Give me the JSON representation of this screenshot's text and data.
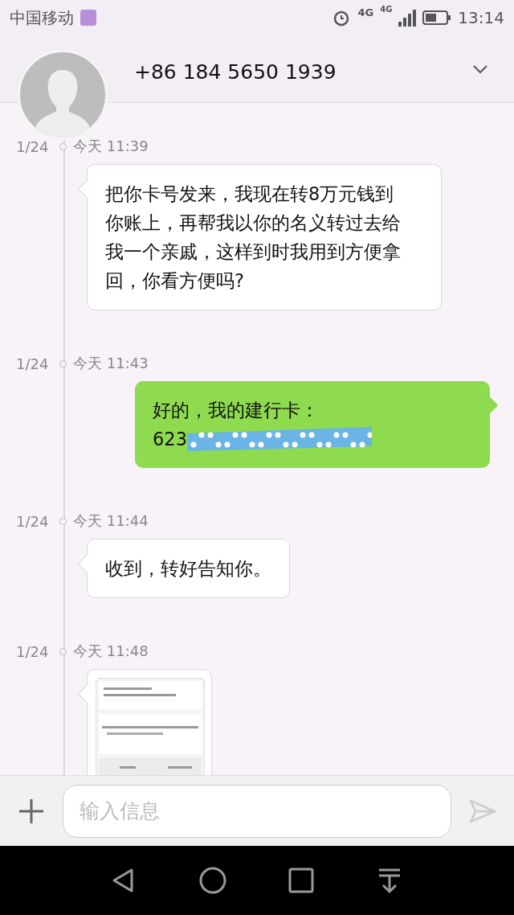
{
  "status_bar": {
    "carrier": "中国移动",
    "network_1": "4G",
    "network_2": "4G",
    "time": "13:14"
  },
  "header": {
    "contact": "+86 184 5650 1939"
  },
  "messages": [
    {
      "date": "1/24",
      "time": "今天 11:39",
      "kind": "received",
      "text": "把你卡号发来，我现在转8万元钱到你账上，再帮我以你的名义转过去给我一个亲戚，这样到时我用到方便拿回，你看方便吗?"
    },
    {
      "date": "1/24",
      "time": "今天 11:43",
      "kind": "sent",
      "text": "好的，我的建行卡：",
      "text_2": "623",
      "redacted": true
    },
    {
      "date": "1/24",
      "time": "今天 11:44",
      "kind": "received",
      "text": "收到，转好告知你。"
    },
    {
      "date": "1/24",
      "time": "今天 11:48"
    }
  ],
  "composer": {
    "placeholder": "输入信息"
  }
}
